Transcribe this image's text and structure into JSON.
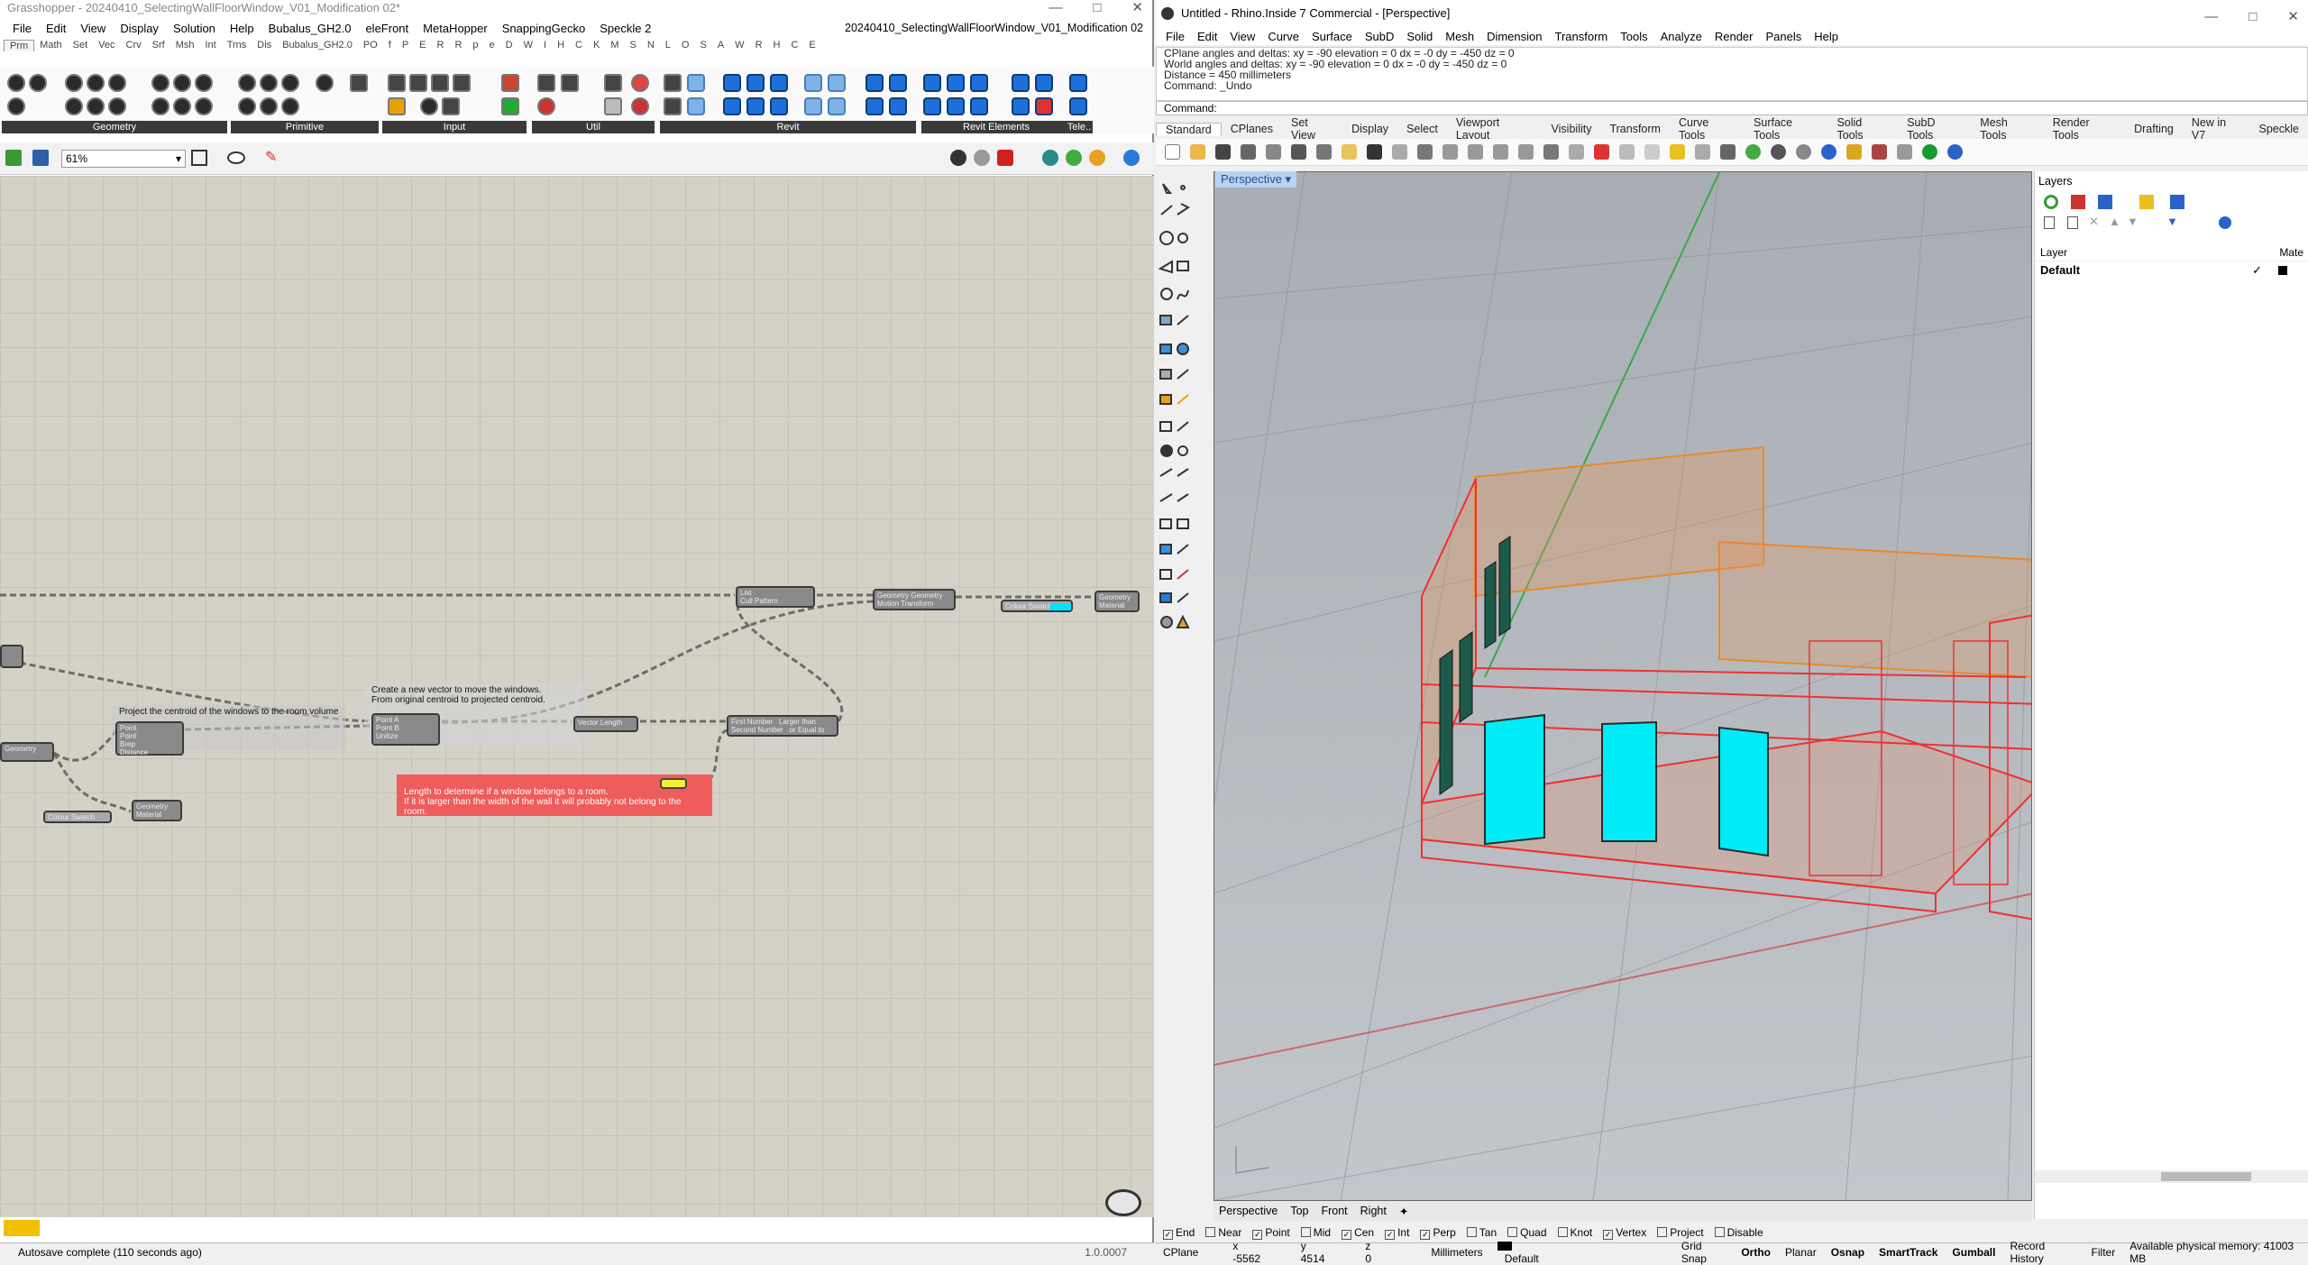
{
  "gh": {
    "title": "Grasshopper - 20240410_SelectingWallFloorWindow_V01_Modification 02*",
    "menu": [
      "File",
      "Edit",
      "View",
      "Display",
      "Solution",
      "Help",
      "Bubalus_GH2.0",
      "eleFront",
      "MetaHopper",
      "SnappingGecko",
      "Speckle 2"
    ],
    "doc_name": "20240410_SelectingWallFloorWindow_V01_Modification 02",
    "tabs": [
      "Prm",
      "Math",
      "Set",
      "Vec",
      "Crv",
      "Srf",
      "Msh",
      "Int",
      "Trns",
      "Dis",
      "Bubalus_GH2.0",
      "PO",
      "f",
      "P",
      "E",
      "R",
      "R",
      "p",
      "e",
      "D",
      "W",
      "I",
      "H",
      "C",
      "K",
      "M",
      "S",
      "N",
      "L",
      "O",
      "S",
      "A",
      "W",
      "R",
      "H",
      "C",
      "E"
    ],
    "ribbon_groups": [
      "Geometry",
      "Primitive",
      "Input",
      "Util",
      "Revit",
      "Revit Elements",
      "Tele.."
    ],
    "zoom": "61%",
    "canvas": {
      "group1": "Project the centroid of the windows to the room volume",
      "group2_line1": "Create a new vector to move the windows.",
      "group2_line2": "From original centroid to projected centroid.",
      "note_line1": "Length to determine if a window belongs to a room.",
      "note_line2": "If it is larger than the width of the wall it will probably not belong to the room.",
      "comp_geometry": "Geometry",
      "comp_project": [
        "Point",
        "Brep",
        "Point",
        "Normal",
        "Distance"
      ],
      "comp_vector": [
        "Point A",
        "Point B",
        "Unitize",
        "Vector",
        "Length"
      ],
      "comp_length": [
        "Vector",
        "Length"
      ],
      "comp_compare": [
        "First Number",
        "Second Number",
        "Larger than",
        "or Equal to"
      ],
      "comp_cull": [
        "List",
        "Cull Pattern",
        "List"
      ],
      "comp_move": [
        "Geometry",
        "Motion",
        "Geometry",
        "Transform"
      ],
      "comp_preview": [
        "Geometry",
        "Material"
      ],
      "comp_colour": "Colour Swatch",
      "comp_preview2": [
        "Geometry",
        "Material"
      ],
      "comp_colour2": "Colour Swatch"
    },
    "status": "Autosave complete (110 seconds ago)",
    "version": "1.0.0007"
  },
  "rhino": {
    "title": "Untitled - Rhino.Inside 7 Commercial - [Perspective]",
    "menu": [
      "File",
      "Edit",
      "View",
      "Curve",
      "Surface",
      "SubD",
      "Solid",
      "Mesh",
      "Dimension",
      "Transform",
      "Tools",
      "Analyze",
      "Render",
      "Panels",
      "Help"
    ],
    "history": [
      "CPlane angles and deltas:  xy = -90  elevation = 0       dx = -0  dy = -450  dz = 0",
      "World angles and deltas:   xy = -90  elevation = 0       dx = -0  dy = -450  dz = 0",
      "Distance = 450 millimeters",
      "Command: _Undo"
    ],
    "command_label": "Command:",
    "toolbar_tabs": [
      "Standard",
      "CPlanes",
      "Set View",
      "Display",
      "Select",
      "Viewport Layout",
      "Visibility",
      "Transform",
      "Curve Tools",
      "Surface Tools",
      "Solid Tools",
      "SubD Tools",
      "Mesh Tools",
      "Render Tools",
      "Drafting",
      "New in V7",
      "Speckle"
    ],
    "viewport_label": "Perspective",
    "viewport_tabs": [
      "Perspective",
      "Top",
      "Front",
      "Right"
    ],
    "layers": {
      "title": "Layers",
      "col_layer": "Layer",
      "col_material": "Mate",
      "row": "Default"
    },
    "osnaps": [
      {
        "label": "End",
        "on": true
      },
      {
        "label": "Near",
        "on": false
      },
      {
        "label": "Point",
        "on": true
      },
      {
        "label": "Mid",
        "on": false
      },
      {
        "label": "Cen",
        "on": true
      },
      {
        "label": "Int",
        "on": true
      },
      {
        "label": "Perp",
        "on": true
      },
      {
        "label": "Tan",
        "on": false
      },
      {
        "label": "Quad",
        "on": false
      },
      {
        "label": "Knot",
        "on": false
      },
      {
        "label": "Vertex",
        "on": true
      },
      {
        "label": "Project",
        "on": false
      },
      {
        "label": "Disable",
        "on": false
      }
    ],
    "status": {
      "cplane": "CPlane",
      "x": "x -5562",
      "y": "y 4514",
      "z": "z 0",
      "units": "Millimeters",
      "layer": "Default",
      "grid": "Grid Snap",
      "ortho": "Ortho",
      "planar": "Planar",
      "osnap": "Osnap",
      "smarttrack": "SmartTrack",
      "gumball": "Gumball",
      "record": "Record History",
      "filter": "Filter",
      "memory": "Available physical memory: 41003 MB"
    }
  }
}
